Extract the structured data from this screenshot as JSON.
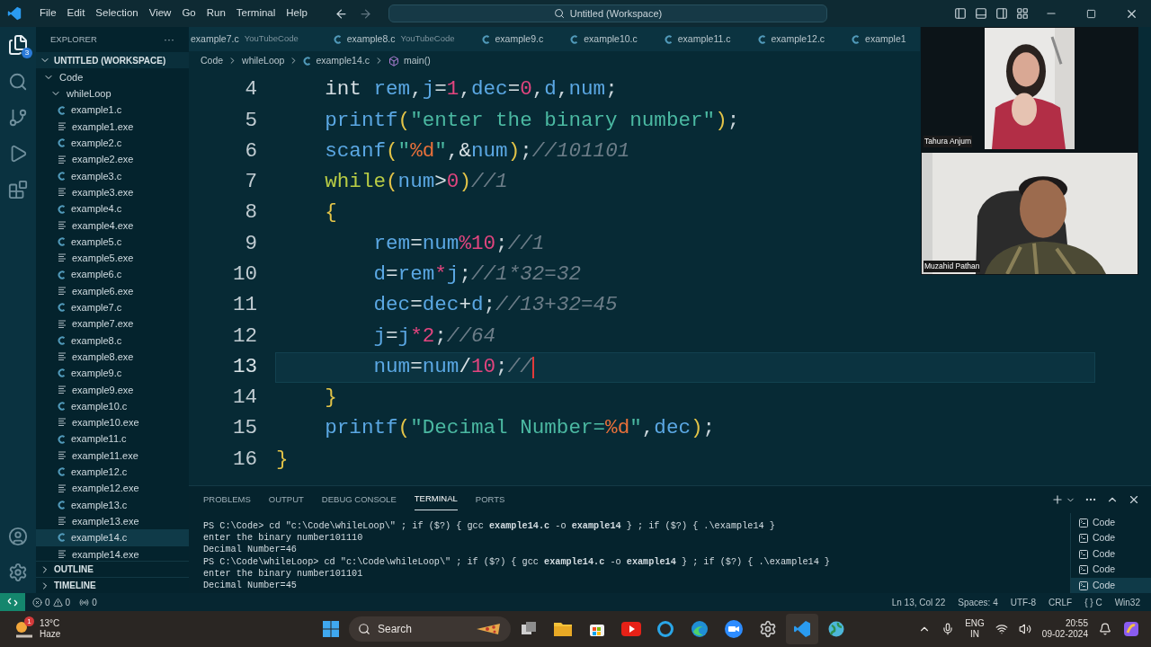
{
  "menu": [
    "File",
    "Edit",
    "Selection",
    "View",
    "Go",
    "Run",
    "Terminal",
    "Help"
  ],
  "command_center": {
    "text": "Untitled (Workspace)"
  },
  "activity_bar": {
    "explorer_badge": "3"
  },
  "sidebar": {
    "title": "EXPLORER",
    "more": "···",
    "workspace": {
      "label": "UNTITLED (WORKSPACE)",
      "expanded": true,
      "children": [
        {
          "label": "Code",
          "kind": "folder",
          "expanded": true,
          "selected": false,
          "children": [
            {
              "label": "whileLoop",
              "kind": "folder",
              "expanded": true,
              "selected": false,
              "children": [
                {
                  "label": "example1.c",
                  "kind": "c",
                  "selected": false
                },
                {
                  "label": "example1.exe",
                  "kind": "exe",
                  "selected": false
                },
                {
                  "label": "example2.c",
                  "kind": "c",
                  "selected": false
                },
                {
                  "label": "example2.exe",
                  "kind": "exe",
                  "selected": false
                },
                {
                  "label": "example3.c",
                  "kind": "c",
                  "selected": false
                },
                {
                  "label": "example3.exe",
                  "kind": "exe",
                  "selected": false
                },
                {
                  "label": "example4.c",
                  "kind": "c",
                  "selected": false
                },
                {
                  "label": "example4.exe",
                  "kind": "exe",
                  "selected": false
                },
                {
                  "label": "example5.c",
                  "kind": "c",
                  "selected": false
                },
                {
                  "label": "example5.exe",
                  "kind": "exe",
                  "selected": false
                },
                {
                  "label": "example6.c",
                  "kind": "c",
                  "selected": false
                },
                {
                  "label": "example6.exe",
                  "kind": "exe",
                  "selected": false
                },
                {
                  "label": "example7.c",
                  "kind": "c",
                  "selected": false
                },
                {
                  "label": "example7.exe",
                  "kind": "exe",
                  "selected": false
                },
                {
                  "label": "example8.c",
                  "kind": "c",
                  "selected": false
                },
                {
                  "label": "example8.exe",
                  "kind": "exe",
                  "selected": false
                },
                {
                  "label": "example9.c",
                  "kind": "c",
                  "selected": false
                },
                {
                  "label": "example9.exe",
                  "kind": "exe",
                  "selected": false
                },
                {
                  "label": "example10.c",
                  "kind": "c",
                  "selected": false
                },
                {
                  "label": "example10.exe",
                  "kind": "exe",
                  "selected": false
                },
                {
                  "label": "example11.c",
                  "kind": "c",
                  "selected": false
                },
                {
                  "label": "example11.exe",
                  "kind": "exe",
                  "selected": false
                },
                {
                  "label": "example12.c",
                  "kind": "c",
                  "selected": false
                },
                {
                  "label": "example12.exe",
                  "kind": "exe",
                  "selected": false
                },
                {
                  "label": "example13.c",
                  "kind": "c",
                  "selected": false
                },
                {
                  "label": "example13.exe",
                  "kind": "exe",
                  "selected": false
                },
                {
                  "label": "example14.c",
                  "kind": "c",
                  "selected": true
                },
                {
                  "label": "example14.exe",
                  "kind": "exe",
                  "selected": false
                }
              ]
            }
          ]
        }
      ]
    },
    "sections": [
      {
        "label": "OUTLINE",
        "expanded": false
      },
      {
        "label": "TIMELINE",
        "expanded": false
      }
    ]
  },
  "tabs": [
    {
      "kind": "partial",
      "label": "example7.c",
      "description": "YouTubeCode",
      "selected": false
    },
    {
      "kind": "file",
      "label": "example8.c",
      "description": "YouTubeCode",
      "selected": false
    },
    {
      "kind": "file",
      "label": "example9.c",
      "selected": false
    },
    {
      "kind": "file",
      "label": "example10.c",
      "selected": false
    },
    {
      "kind": "file",
      "label": "example11.c",
      "selected": false
    },
    {
      "kind": "file",
      "label": "example12.c",
      "selected": false
    },
    {
      "kind": "file",
      "label": "example1",
      "selected": false
    }
  ],
  "breadcrumb": [
    {
      "kind": "folder",
      "label": "Code"
    },
    {
      "kind": "folder",
      "label": "whileLoop"
    },
    {
      "kind": "c",
      "label": "example14.c"
    },
    {
      "kind": "function",
      "label": "main()"
    }
  ],
  "editor": {
    "lines": [
      {
        "number": "4",
        "current": false,
        "tokens": [
          {
            "text": "    int",
            "kind": "kw"
          },
          {
            "text": " rem",
            "kind": "var"
          },
          {
            "text": ",",
            "kind": "p"
          },
          {
            "text": "j",
            "kind": "var"
          },
          {
            "text": "=",
            "kind": "op"
          },
          {
            "text": "1",
            "kind": "num"
          },
          {
            "text": ",",
            "kind": "p"
          },
          {
            "text": "dec",
            "kind": "var"
          },
          {
            "text": "=",
            "kind": "op"
          },
          {
            "text": "0",
            "kind": "num"
          },
          {
            "text": ",",
            "kind": "p"
          },
          {
            "text": "d",
            "kind": "var"
          },
          {
            "text": ",",
            "kind": "p"
          },
          {
            "text": "num",
            "kind": "var"
          },
          {
            "text": ";",
            "kind": "p"
          }
        ]
      },
      {
        "number": "5",
        "current": false,
        "tokens": [
          {
            "text": "    printf",
            "kind": "fn"
          },
          {
            "text": "(",
            "kind": "br"
          },
          {
            "text": "\"enter the binary number\"",
            "kind": "str"
          },
          {
            "text": ")",
            "kind": "br"
          },
          {
            "text": ";",
            "kind": "p"
          }
        ]
      },
      {
        "number": "6",
        "current": false,
        "tokens": [
          {
            "text": "    scanf",
            "kind": "fn"
          },
          {
            "text": "(",
            "kind": "br"
          },
          {
            "text": "\"",
            "kind": "str"
          },
          {
            "text": "%d",
            "kind": "fmt"
          },
          {
            "text": "\"",
            "kind": "str"
          },
          {
            "text": ",",
            "kind": "p"
          },
          {
            "text": "&",
            "kind": "op"
          },
          {
            "text": "num",
            "kind": "var"
          },
          {
            "text": ")",
            "kind": "br"
          },
          {
            "text": ";",
            "kind": "p"
          },
          {
            "text": "//101101",
            "kind": "cm"
          }
        ]
      },
      {
        "number": "7",
        "current": false,
        "tokens": [
          {
            "text": "    while",
            "kind": "ctl"
          },
          {
            "text": "(",
            "kind": "br"
          },
          {
            "text": "num",
            "kind": "var"
          },
          {
            "text": ">",
            "kind": "op"
          },
          {
            "text": "0",
            "kind": "num"
          },
          {
            "text": ")",
            "kind": "br"
          },
          {
            "text": "//1",
            "kind": "cm"
          }
        ]
      },
      {
        "number": "8",
        "current": false,
        "tokens": [
          {
            "text": "    {",
            "kind": "br"
          }
        ]
      },
      {
        "number": "9",
        "current": false,
        "tokens": [
          {
            "text": "        rem",
            "kind": "var"
          },
          {
            "text": "=",
            "kind": "op"
          },
          {
            "text": "num",
            "kind": "var"
          },
          {
            "text": "%",
            "kind": "num"
          },
          {
            "text": "10",
            "kind": "num"
          },
          {
            "text": ";",
            "kind": "p"
          },
          {
            "text": "//1",
            "kind": "cm"
          }
        ]
      },
      {
        "number": "10",
        "current": false,
        "tokens": [
          {
            "text": "        d",
            "kind": "var"
          },
          {
            "text": "=",
            "kind": "op"
          },
          {
            "text": "rem",
            "kind": "var"
          },
          {
            "text": "*",
            "kind": "num"
          },
          {
            "text": "j",
            "kind": "var"
          },
          {
            "text": ";",
            "kind": "p"
          },
          {
            "text": "//1*32=32",
            "kind": "cm"
          }
        ]
      },
      {
        "number": "11",
        "current": false,
        "tokens": [
          {
            "text": "        dec",
            "kind": "var"
          },
          {
            "text": "=",
            "kind": "op"
          },
          {
            "text": "dec",
            "kind": "var"
          },
          {
            "text": "+",
            "kind": "op"
          },
          {
            "text": "d",
            "kind": "var"
          },
          {
            "text": ";",
            "kind": "p"
          },
          {
            "text": "//13+32=45",
            "kind": "cm"
          }
        ]
      },
      {
        "number": "12",
        "current": false,
        "tokens": [
          {
            "text": "        j",
            "kind": "var"
          },
          {
            "text": "=",
            "kind": "op"
          },
          {
            "text": "j",
            "kind": "var"
          },
          {
            "text": "*",
            "kind": "num"
          },
          {
            "text": "2",
            "kind": "num"
          },
          {
            "text": ";",
            "kind": "p"
          },
          {
            "text": "//64",
            "kind": "cm"
          }
        ]
      },
      {
        "number": "13",
        "current": true,
        "tokens": [
          {
            "text": "        num",
            "kind": "var"
          },
          {
            "text": "=",
            "kind": "op"
          },
          {
            "text": "num",
            "kind": "var"
          },
          {
            "text": "/",
            "kind": "op"
          },
          {
            "text": "10",
            "kind": "num"
          },
          {
            "text": ";",
            "kind": "p"
          },
          {
            "text": "//",
            "kind": "cm"
          }
        ]
      },
      {
        "number": "14",
        "current": false,
        "tokens": [
          {
            "text": "    }",
            "kind": "br"
          }
        ]
      },
      {
        "number": "15",
        "current": false,
        "tokens": [
          {
            "text": "    printf",
            "kind": "fn"
          },
          {
            "text": "(",
            "kind": "br"
          },
          {
            "text": "\"Decimal Number=",
            "kind": "str"
          },
          {
            "text": "%d",
            "kind": "fmt"
          },
          {
            "text": "\"",
            "kind": "str"
          },
          {
            "text": ",",
            "kind": "p"
          },
          {
            "text": "dec",
            "kind": "var"
          },
          {
            "text": ")",
            "kind": "br"
          },
          {
            "text": ";",
            "kind": "p"
          }
        ]
      },
      {
        "number": "16",
        "current": false,
        "tokens": [
          {
            "text": "}",
            "kind": "br"
          }
        ]
      }
    ]
  },
  "panel": {
    "tabs": [
      {
        "label": "PROBLEMS",
        "selected": false
      },
      {
        "label": "OUTPUT",
        "selected": false
      },
      {
        "label": "DEBUG CONSOLE",
        "selected": false
      },
      {
        "label": "TERMINAL",
        "selected": true
      },
      {
        "label": "PORTS",
        "selected": false
      }
    ],
    "terminal_lines": [
      "PS C:\\Code> cd \"c:\\Code\\whileLoop\\\" ; if ($?) { gcc **example14.c** -o **example14** } ; if ($?) { .\\example14 }",
      "enter the binary number101110",
      "Decimal Number=46",
      "PS C:\\Code\\whileLoop> cd \"c:\\Code\\whileLoop\\\" ; if ($?) { gcc **example14.c** -o **example14** } ; if ($?) { .\\example14 }",
      "enter the binary number101101",
      "Decimal Number=45"
    ],
    "terminals": [
      {
        "label": "Code",
        "selected": false
      },
      {
        "label": "Code",
        "selected": false
      },
      {
        "label": "Code",
        "selected": false
      },
      {
        "label": "Code",
        "selected": false
      },
      {
        "label": "Code",
        "selected": true
      }
    ]
  },
  "status_bar": {
    "errors": "0",
    "warnings": "0",
    "ports": "0",
    "right": [
      "Ln 13, Col 22",
      "Spaces: 4",
      "UTF-8",
      "CRLF",
      "{ } C",
      "Win32"
    ]
  },
  "video_call": [
    {
      "name": "Tahura Anjum",
      "kind": "picture"
    },
    {
      "name": "Muzahid Pathan",
      "kind": "picture"
    }
  ],
  "taskbar": {
    "weather": {
      "badge": "1",
      "temperature": "13°C",
      "condition": "Haze"
    },
    "search": "Search",
    "apps": [
      {
        "kind": "taskview"
      },
      {
        "kind": "folder"
      },
      {
        "kind": "store"
      },
      {
        "kind": "youtube"
      },
      {
        "kind": "ring"
      },
      {
        "kind": "edge"
      },
      {
        "kind": "zoom"
      },
      {
        "kind": "gear"
      },
      {
        "kind": "vscode"
      },
      {
        "kind": "globe"
      }
    ],
    "language": [
      "ENG",
      "IN"
    ],
    "time": "20:55",
    "date": "09-02-2024"
  }
}
